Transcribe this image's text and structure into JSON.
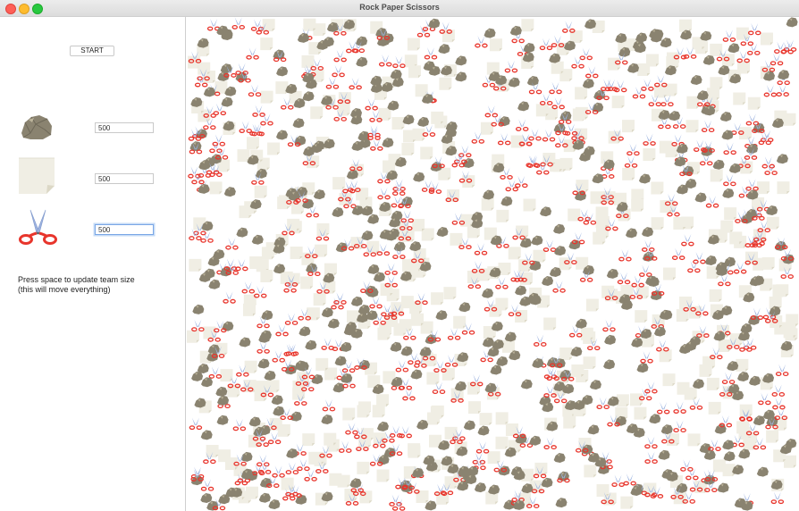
{
  "window": {
    "title": "Rock Paper Scissors"
  },
  "controls": {
    "start_label": "START",
    "teams": [
      {
        "name": "rock",
        "icon": "rock-icon",
        "count": "500"
      },
      {
        "name": "paper",
        "icon": "paper-icon",
        "count": "500"
      },
      {
        "name": "scissors",
        "icon": "scissors-icon",
        "count": "500"
      }
    ],
    "hint_line1": "Press space to update team size",
    "hint_line2": "(this will move everything)"
  },
  "colors": {
    "rock": "#8a8370",
    "paper": "#f0eee4",
    "scissors_handle": "#e8352c",
    "scissors_blade": "#9db3e0"
  }
}
